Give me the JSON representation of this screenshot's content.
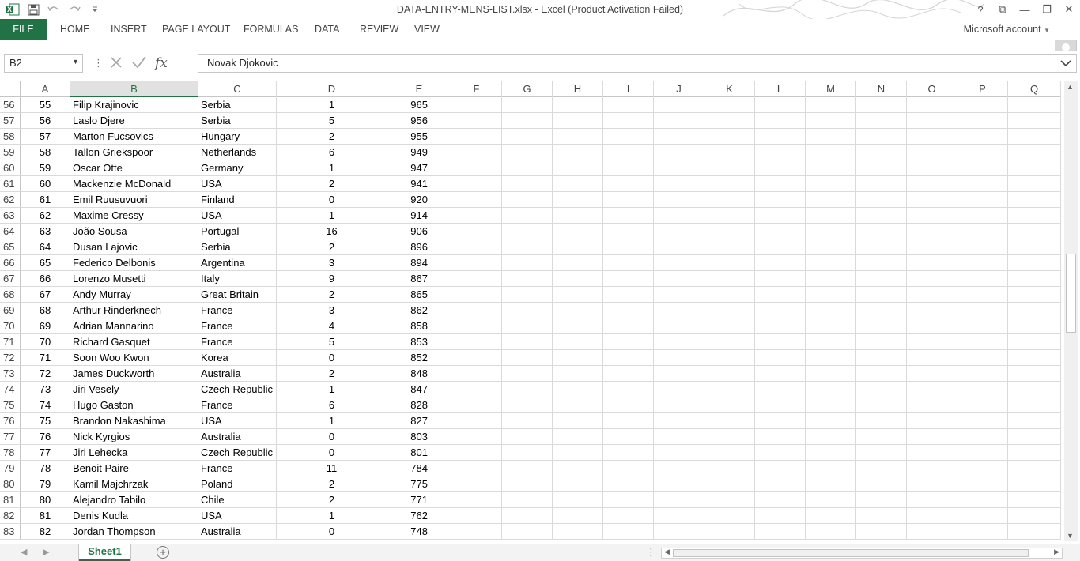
{
  "title_bar": {
    "title": "DATA-ENTRY-MENS-LIST.xlsx - Excel (Product Activation Failed)",
    "controls": [
      "?",
      "⧉",
      "—",
      "❐",
      "✕"
    ]
  },
  "ribbon": {
    "file": "FILE",
    "tabs": [
      "HOME",
      "INSERT",
      "PAGE LAYOUT",
      "FORMULAS",
      "DATA",
      "REVIEW",
      "VIEW"
    ],
    "account": "Microsoft account"
  },
  "formula_bar": {
    "name_box": "B2",
    "separator": "⋮",
    "fx": "fx",
    "value": "Novak Djokovic"
  },
  "columns": [
    "A",
    "B",
    "C",
    "D",
    "E",
    "F",
    "G",
    "H",
    "I",
    "J",
    "K",
    "L",
    "M",
    "N",
    "O",
    "P",
    "Q"
  ],
  "selected_column": "B",
  "rows": [
    {
      "n": "56",
      "a": "55",
      "b": "Filip Krajinovic",
      "c": "Serbia",
      "d": "1",
      "e": "965"
    },
    {
      "n": "57",
      "a": "56",
      "b": "Laslo Djere",
      "c": "Serbia",
      "d": "5",
      "e": "956"
    },
    {
      "n": "58",
      "a": "57",
      "b": "Marton Fucsovics",
      "c": "Hungary",
      "d": "2",
      "e": "955"
    },
    {
      "n": "59",
      "a": "58",
      "b": "Tallon Griekspoor",
      "c": "Netherlands",
      "d": "6",
      "e": "949"
    },
    {
      "n": "60",
      "a": "59",
      "b": "Oscar Otte",
      "c": "Germany",
      "d": "1",
      "e": "947"
    },
    {
      "n": "61",
      "a": "60",
      "b": "Mackenzie McDonald",
      "c": "USA",
      "d": "2",
      "e": "941"
    },
    {
      "n": "62",
      "a": "61",
      "b": "Emil Ruusuvuori",
      "c": "Finland",
      "d": "0",
      "e": "920"
    },
    {
      "n": "63",
      "a": "62",
      "b": "Maxime Cressy",
      "c": "USA",
      "d": "1",
      "e": "914"
    },
    {
      "n": "64",
      "a": "63",
      "b": "João Sousa",
      "c": "Portugal",
      "d": "16",
      "e": "906"
    },
    {
      "n": "65",
      "a": "64",
      "b": "Dusan Lajovic",
      "c": "Serbia",
      "d": "2",
      "e": "896"
    },
    {
      "n": "66",
      "a": "65",
      "b": "Federico Delbonis",
      "c": "Argentina",
      "d": "3",
      "e": "894"
    },
    {
      "n": "67",
      "a": "66",
      "b": "Lorenzo Musetti",
      "c": "Italy",
      "d": "9",
      "e": "867"
    },
    {
      "n": "68",
      "a": "67",
      "b": "Andy Murray",
      "c": "Great Britain",
      "d": "2",
      "e": "865"
    },
    {
      "n": "69",
      "a": "68",
      "b": "Arthur Rinderknech",
      "c": "France",
      "d": "3",
      "e": "862"
    },
    {
      "n": "70",
      "a": "69",
      "b": "Adrian Mannarino",
      "c": "France",
      "d": "4",
      "e": "858"
    },
    {
      "n": "71",
      "a": "70",
      "b": "Richard Gasquet",
      "c": "France",
      "d": "5",
      "e": "853"
    },
    {
      "n": "72",
      "a": "71",
      "b": "Soon Woo Kwon",
      "c": "Korea",
      "d": "0",
      "e": "852"
    },
    {
      "n": "73",
      "a": "72",
      "b": "James Duckworth",
      "c": "Australia",
      "d": "2",
      "e": "848"
    },
    {
      "n": "74",
      "a": "73",
      "b": "Jiri Vesely",
      "c": "Czech Republic",
      "d": "1",
      "e": "847"
    },
    {
      "n": "75",
      "a": "74",
      "b": "Hugo Gaston",
      "c": "France",
      "d": "6",
      "e": "828"
    },
    {
      "n": "76",
      "a": "75",
      "b": "Brandon Nakashima",
      "c": "USA",
      "d": "1",
      "e": "827"
    },
    {
      "n": "77",
      "a": "76",
      "b": "Nick Kyrgios",
      "c": "Australia",
      "d": "0",
      "e": "803"
    },
    {
      "n": "78",
      "a": "77",
      "b": "Jiri Lehecka",
      "c": "Czech Republic",
      "d": "0",
      "e": "801"
    },
    {
      "n": "79",
      "a": "78",
      "b": "Benoit Paire",
      "c": "France",
      "d": "11",
      "e": "784"
    },
    {
      "n": "80",
      "a": "79",
      "b": "Kamil Majchrzak",
      "c": "Poland",
      "d": "2",
      "e": "775"
    },
    {
      "n": "81",
      "a": "80",
      "b": "Alejandro Tabilo",
      "c": "Chile",
      "d": "2",
      "e": "771"
    },
    {
      "n": "82",
      "a": "81",
      "b": "Denis Kudla",
      "c": "USA",
      "d": "1",
      "e": "762"
    },
    {
      "n": "83",
      "a": "82",
      "b": "Jordan Thompson",
      "c": "Australia",
      "d": "0",
      "e": "748"
    }
  ],
  "sheet_bar": {
    "sheet_name": "Sheet1",
    "add_sheet": "+"
  },
  "theme": {
    "accent": "#217346"
  }
}
